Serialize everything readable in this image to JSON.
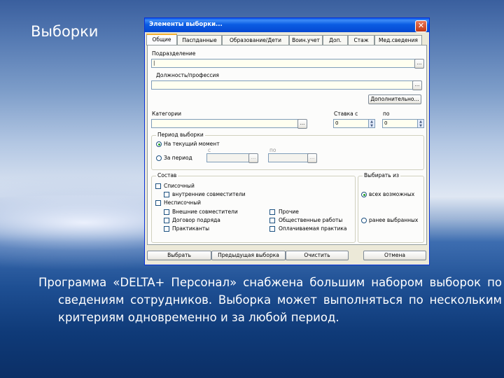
{
  "slide": {
    "title": "Выборки",
    "text": "Программа «DELTA+ Персонал» снабжена большим набором выборок по сведениям сотрудников. Выборка может выполняться по нескольким критериям одновременно и за любой период."
  },
  "dialog": {
    "title": "Элементы выборки...",
    "close_glyph": "✕",
    "tabs": [
      "Общие",
      "Паспданные",
      "Образование/Дети",
      "Воин.учет",
      "Доп.",
      "Стаж",
      "Мед.сведения"
    ],
    "active_tab": "Общие",
    "dots": "...",
    "fields": {
      "department_label": "Подразделение",
      "department_value": "|",
      "position_label": "Должность/профессия",
      "more_button": "Дополнительно...",
      "categories_label": "Категории",
      "rate_from_label": "Ставка с",
      "rate_from_value": "0",
      "rate_to_label": "по",
      "rate_to_value": "0"
    },
    "period": {
      "legend": "Период выборки",
      "current": "На текущий момент",
      "range": "За период",
      "from_label": "с",
      "to_label": "по"
    },
    "composition": {
      "legend": "Состав",
      "listed": "Списочный",
      "internal": "внутренние совместители",
      "nonlisted": "Несписочный",
      "external": "Внешние совместители",
      "contract": "Договор подряда",
      "interns": "Практиканты",
      "other": "Прочие",
      "public_works": "Общественные работы",
      "paid_practice": "Оплачиваемая практика"
    },
    "choose_from": {
      "legend": "Выбирать из",
      "all": "всех возможных",
      "previous": "ранее выбранных"
    },
    "buttons": {
      "select": "Выбрать",
      "previous": "Предыдущая выборка",
      "clear": "Очистить",
      "cancel": "Отмена"
    }
  }
}
